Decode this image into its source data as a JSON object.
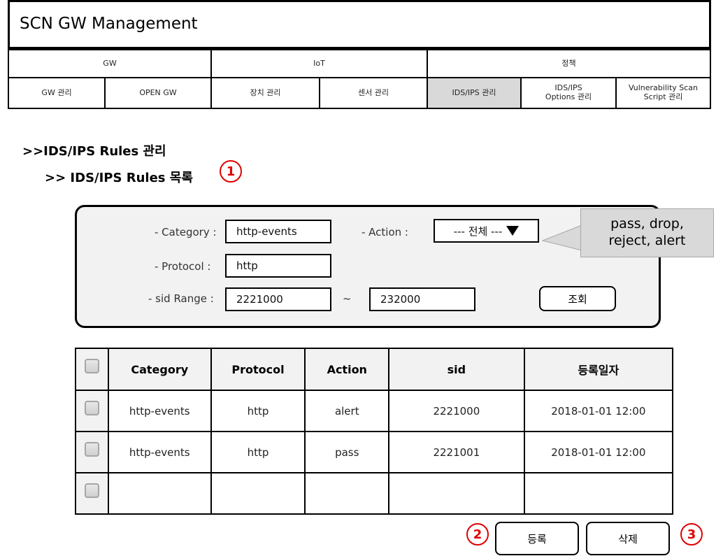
{
  "app": {
    "title": "SCN GW Management"
  },
  "nav": {
    "groups": [
      "GW",
      "IoT",
      "정책"
    ],
    "tabs": [
      {
        "label": "GW 관리"
      },
      {
        "label": "OPEN GW"
      },
      {
        "label": "장치 관리"
      },
      {
        "label": "센서 관리"
      },
      {
        "label": "IDS/IPS 관리",
        "active": true
      },
      {
        "label_line1": "IDS/IPS",
        "label_line2": "Options 관리"
      },
      {
        "label_line1": "Vulnerability Scan",
        "label_line2": "Script 관리"
      }
    ]
  },
  "breadcrumb": {
    "section": ">>IDS/IPS Rules 관리",
    "subsection": ">> IDS/IPS Rules  목록"
  },
  "markers": {
    "m1": "1",
    "m2": "2",
    "m3": "3"
  },
  "search": {
    "category_label": "- Category :",
    "category_value": "http-events",
    "action_label": "- Action :",
    "action_value": "---  전체 ---",
    "protocol_label": "- Protocol :",
    "protocol_value": "http",
    "sid_label": "- sid  Range :",
    "sid_from": "2221000",
    "sid_sep": "~",
    "sid_to": "232000",
    "search_button": "조회"
  },
  "callout": {
    "line1": "pass, drop,",
    "line2": "reject, alert"
  },
  "table": {
    "headers": [
      "Category",
      "Protocol",
      "Action",
      "sid",
      "등록일자"
    ],
    "rows": [
      [
        "http-events",
        "http",
        "alert",
        "2221000",
        "2018-01-01  12:00"
      ],
      [
        "http-events",
        "http",
        "pass",
        "2221001",
        "2018-01-01  12:00"
      ],
      [
        "",
        "",
        "",
        "",
        ""
      ]
    ]
  },
  "actions": {
    "register": "등록",
    "delete": "삭제"
  },
  "colors": {
    "active_tab": "#d9d9d9",
    "panel_bg": "#f2f2f2",
    "marker": "#e00000",
    "callout_bg": "#d9d9d9"
  }
}
